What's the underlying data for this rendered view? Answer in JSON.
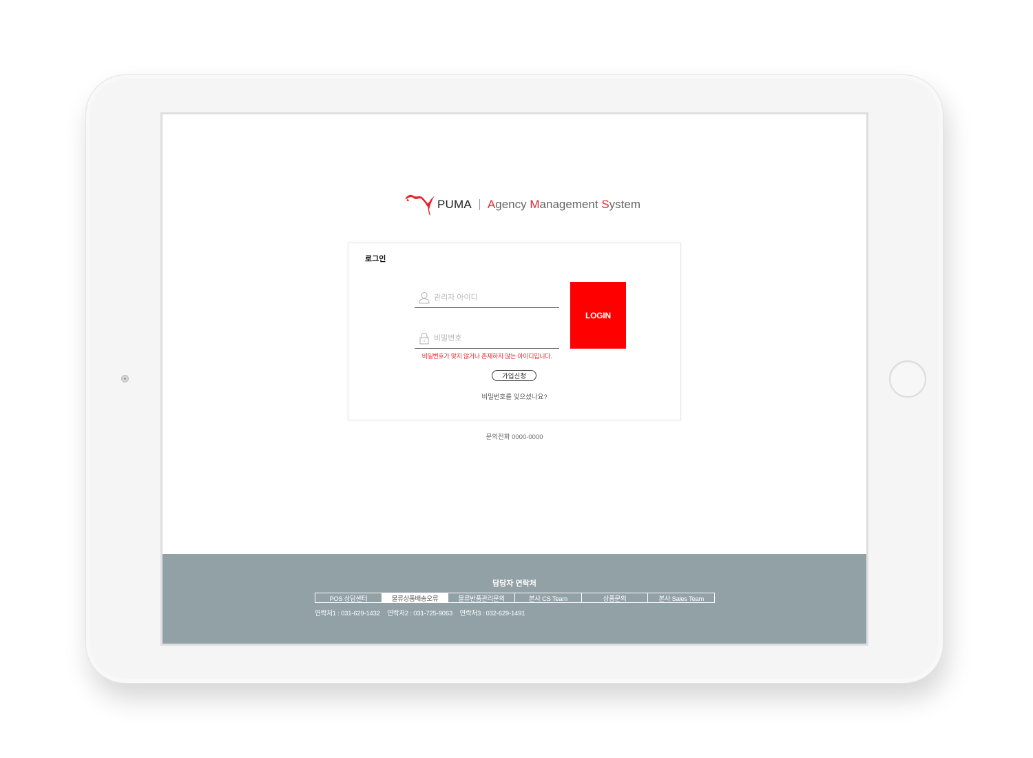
{
  "brand": {
    "name": "PUMA",
    "system_title": "Agency Management System",
    "title_parts": {
      "a": "A",
      "gency": "gency ",
      "m": "M",
      "anagement": "anagement ",
      "s": "S",
      "ystem": "ystem"
    },
    "accent_color": "#e8242b"
  },
  "login": {
    "title": "로그인",
    "id_placeholder": "관리자 아이디",
    "pw_placeholder": "비밀번호",
    "error_message": "비밀번호가 맞지 않거나 존재하지 않는 아이디입니다.",
    "login_button": "LOGIN",
    "login_button_color": "#ff0000",
    "signup_button": "가입신청",
    "forgot_link": "비밀번호를 잊으셨나요?",
    "phone_inquiry": "문의전화 0000-0000"
  },
  "footer": {
    "title": "담당자 연락처",
    "background_color": "#92a1a5",
    "tabs": [
      {
        "label": "POS 상담센터",
        "active": false
      },
      {
        "label": "물류상품배송오류",
        "active": true
      },
      {
        "label": "물류반품관리문의",
        "active": false
      },
      {
        "label": "본사 CS Team",
        "active": false
      },
      {
        "label": "상품문의",
        "active": false
      },
      {
        "label": "본사 Sales Team",
        "active": false
      }
    ],
    "contacts": [
      "연락처1 : 031-629-1432",
      "연락처2 : 031-725-9063",
      "연락처3 : 032-629-1491"
    ]
  },
  "icons": {
    "logo": "puma-cat-icon",
    "id_field": "user-icon",
    "pw_field": "lock-icon"
  }
}
